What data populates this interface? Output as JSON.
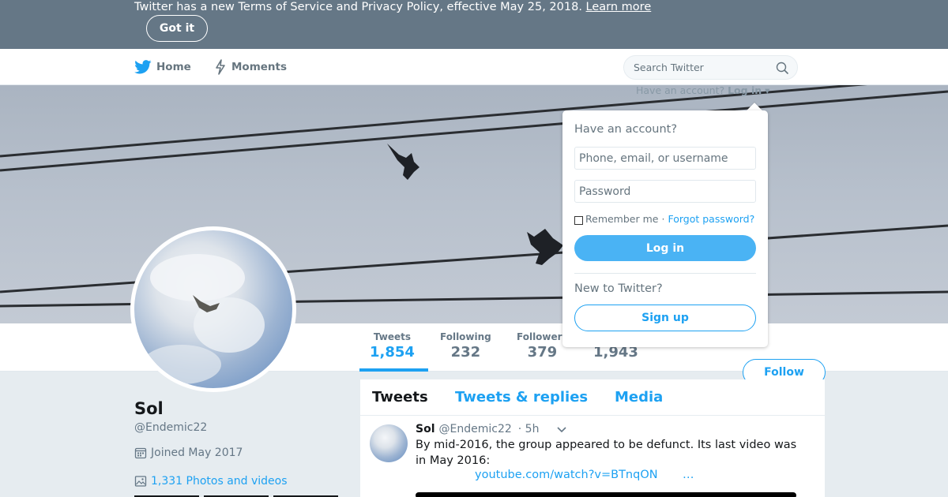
{
  "banner": {
    "text": "Twitter has a new Terms of Service and Privacy Policy, effective May 25, 2018.",
    "link_label": "Learn more",
    "dismiss_label": "Got it"
  },
  "nav": {
    "home_label": "Home",
    "moments_label": "Moments",
    "search_placeholder": "Search Twitter",
    "login_prompt": "Have an account?",
    "login_label": "Log in"
  },
  "login_panel": {
    "title": "Have an account?",
    "username_placeholder": "Phone, email, or username",
    "password_placeholder": "Password",
    "remember_label": "Remember me",
    "separator": "·",
    "forgot_label": "Forgot password?",
    "login_button": "Log in",
    "new_user_text": "New to Twitter?",
    "signup_button": "Sign up"
  },
  "profile": {
    "name": "Sol",
    "handle": "@Endemic22",
    "joined": "Joined May 2017",
    "photos_label": "1,331 Photos and videos",
    "follow_label": "Follow"
  },
  "stats": [
    {
      "label": "Tweets",
      "value": "1,854"
    },
    {
      "label": "Following",
      "value": "232"
    },
    {
      "label": "Followers",
      "value": "379"
    },
    {
      "label": "",
      "value": "1,943"
    }
  ],
  "timeline": {
    "tabs": [
      "Tweets",
      "Tweets & replies",
      "Media"
    ]
  },
  "tweet": {
    "name": "Sol",
    "handle": "@Endemic22",
    "time": "· 5h",
    "text": "By mid-2016, the group appeared to be defunct. Its last video was in May 2016:",
    "link": "youtube.com/watch?v=BTnqON",
    "ellipsis": "…"
  },
  "colors": {
    "accent": "#1da1f2",
    "banner": "#657786",
    "background": "#e6ecf0"
  }
}
